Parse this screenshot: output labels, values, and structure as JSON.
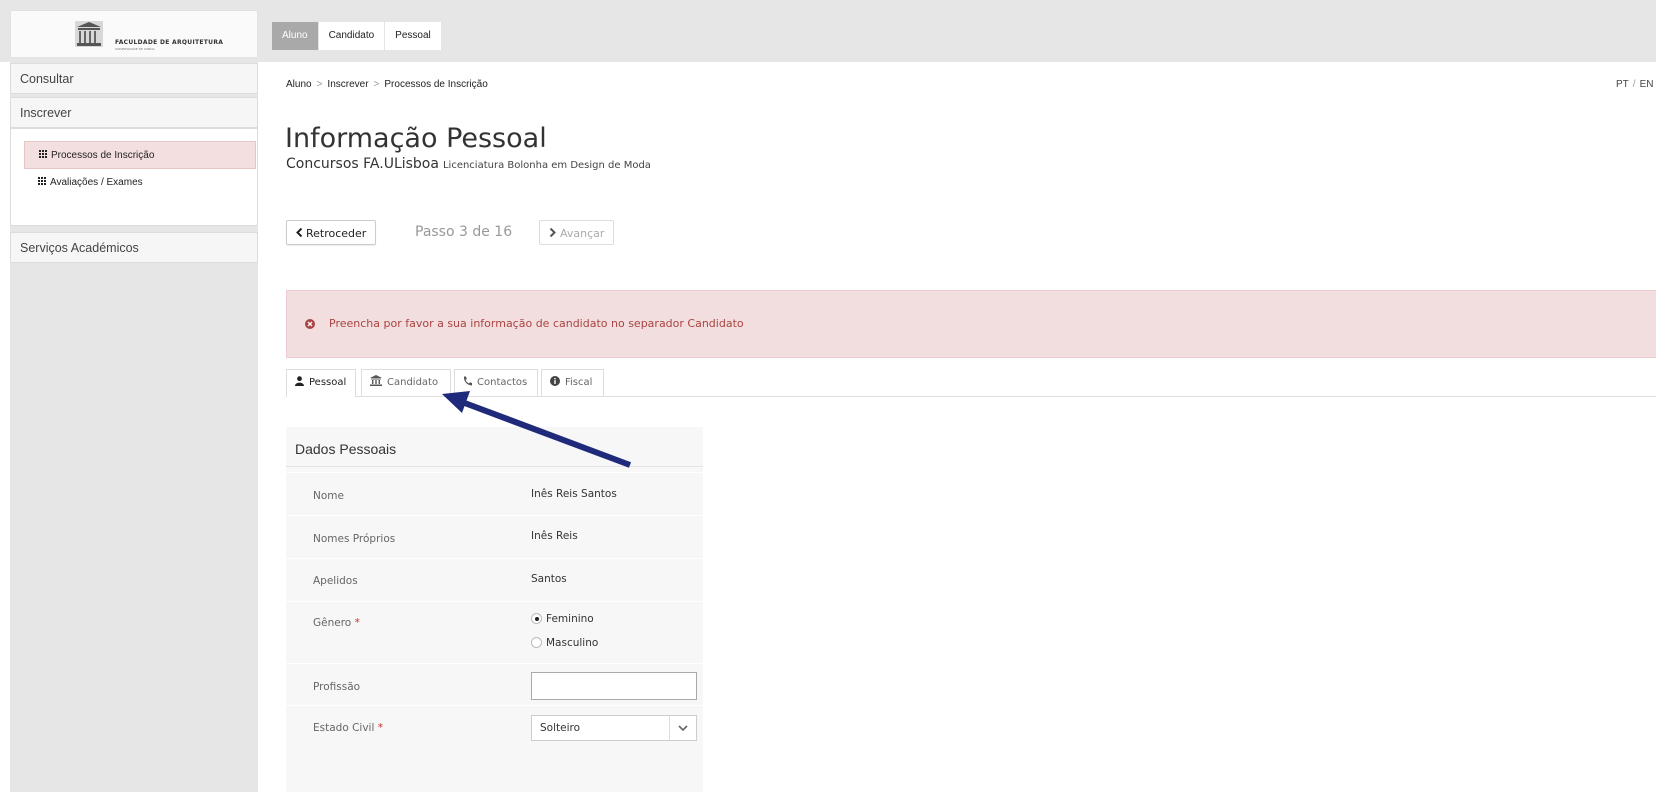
{
  "logo": {
    "text": "FACULDADE DE ARQUITETURA",
    "subtext": "UNIVERSIDADE DE LISBOA"
  },
  "top_tabs": [
    {
      "label": "Aluno",
      "active": true
    },
    {
      "label": "Candidato",
      "active": false
    },
    {
      "label": "Pessoal",
      "active": false
    }
  ],
  "sidebar": {
    "consultar": "Consultar",
    "inscrever": "Inscrever",
    "links": [
      {
        "label": "Processos de Inscrição",
        "active": true
      },
      {
        "label": "Avaliações / Exames",
        "active": false
      }
    ],
    "servicos": "Serviços Académicos"
  },
  "breadcrumb": [
    "Aluno",
    "Inscrever",
    "Processos de Inscrição"
  ],
  "breadcrumb_sep": ">",
  "lang": {
    "pt": "PT",
    "sep": "/",
    "en": "EN"
  },
  "page": {
    "title": "Informação Pessoal",
    "subtitle": "Concursos FA.ULisboa",
    "subtitle_small": "Licenciatura Bolonha em Design de Moda"
  },
  "stepper": {
    "back": "Retroceder",
    "step": "Passo 3 de 16",
    "next": "Avançar"
  },
  "alert": {
    "text": "Preencha por favor a sua informação de candidato no separador Candidato",
    "color": "#a94442"
  },
  "tabs": [
    {
      "label": "Pessoal",
      "icon": "user-icon",
      "active": true
    },
    {
      "label": "Candidato",
      "icon": "institution-icon",
      "active": false
    },
    {
      "label": "Contactos",
      "icon": "phone-icon",
      "active": false
    },
    {
      "label": "Fiscal",
      "icon": "info-icon",
      "active": false
    }
  ],
  "section": {
    "title": "Dados Pessoais",
    "fields": {
      "nome": {
        "label": "Nome",
        "value": "Inês Reis Santos"
      },
      "nomes_proprios": {
        "label": "Nomes Próprios",
        "value": "Inês Reis"
      },
      "apelidos": {
        "label": "Apelidos",
        "value": "Santos"
      },
      "genero": {
        "label": "Gênero",
        "required": "*",
        "options": [
          "Feminino",
          "Masculino"
        ],
        "selected": "Feminino"
      },
      "profissao": {
        "label": "Profissão",
        "value": ""
      },
      "estado_civil": {
        "label": "Estado Civil",
        "required": "*",
        "value": "Solteiro"
      }
    }
  },
  "annotation_color": "#1f2a7a"
}
